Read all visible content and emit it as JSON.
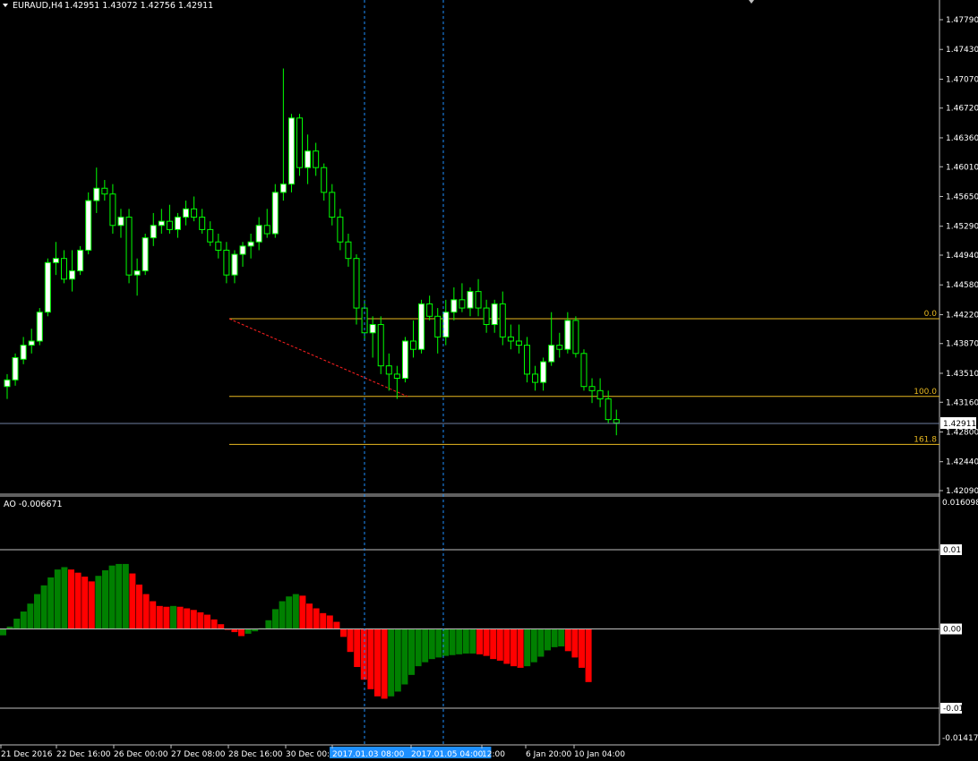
{
  "header": {
    "symbol_label": "EURAUD,H4",
    "ohlc_label": "1.42951 1.43072 1.42756 1.42911"
  },
  "price_axis": {
    "ticks": [
      "1.47790",
      "1.47430",
      "1.47070",
      "1.46720",
      "1.46360",
      "1.46010",
      "1.45650",
      "1.45290",
      "1.44940",
      "1.44580",
      "1.44220",
      "1.43870",
      "1.43510",
      "1.43160",
      "1.42800",
      "1.42440",
      "1.42090"
    ],
    "ymin": 1.4209,
    "ymax": 1.4779,
    "current_price_label": "1.42911",
    "current_price": 1.42911
  },
  "fibonacci": {
    "levels": [
      {
        "label": "0.0",
        "price": 1.4417
      },
      {
        "label": "100.0",
        "price": 1.4323
      },
      {
        "label": "161.8",
        "price": 1.4265
      }
    ],
    "color": "#e8b820",
    "trendline_color": "#ff2020"
  },
  "time_axis": {
    "labels": [
      "21 Dec 2016",
      "22 Dec 16:00",
      "26 Dec 00:00",
      "27 Dec 08:00",
      "28 Dec 16:00",
      "30 Dec 00:00",
      "2017.01.03 08:00",
      "2017.01.05 04:00",
      "12:00",
      "6 Jan 20:00",
      "10 Jan 04:00"
    ],
    "highlighted": [
      "2017.01.03 08:00",
      "2017.01.05 04:00"
    ]
  },
  "indicator": {
    "name_label": "AO -0.006671",
    "ticks": [
      "0.016098",
      "0.01",
      "0.00",
      "-0.01",
      "-0.014174"
    ],
    "up_color": "#008000",
    "down_color": "#ff0000"
  },
  "colors": {
    "background": "#000000",
    "bull_candle": "#ffffff",
    "candle_outline": "#00ff00",
    "grid": "#c0c0c0",
    "crosshair": "#1e90ff"
  },
  "chart_data": {
    "type": "candlestick",
    "symbol": "EURAUD",
    "timeframe": "H4",
    "candles": [
      {
        "o": 1.4335,
        "h": 1.435,
        "l": 1.432,
        "c": 1.4343
      },
      {
        "o": 1.4343,
        "h": 1.4375,
        "l": 1.4336,
        "c": 1.437
      },
      {
        "o": 1.4368,
        "h": 1.4395,
        "l": 1.4362,
        "c": 1.4385
      },
      {
        "o": 1.4385,
        "h": 1.4405,
        "l": 1.4375,
        "c": 1.439
      },
      {
        "o": 1.439,
        "h": 1.443,
        "l": 1.4385,
        "c": 1.4425
      },
      {
        "o": 1.4425,
        "h": 1.449,
        "l": 1.442,
        "c": 1.4485
      },
      {
        "o": 1.4485,
        "h": 1.451,
        "l": 1.447,
        "c": 1.449
      },
      {
        "o": 1.449,
        "h": 1.45,
        "l": 1.446,
        "c": 1.4465
      },
      {
        "o": 1.4465,
        "h": 1.45,
        "l": 1.445,
        "c": 1.4475
      },
      {
        "o": 1.4475,
        "h": 1.4505,
        "l": 1.447,
        "c": 1.45
      },
      {
        "o": 1.45,
        "h": 1.457,
        "l": 1.4495,
        "c": 1.456
      },
      {
        "o": 1.456,
        "h": 1.46,
        "l": 1.4545,
        "c": 1.4575
      },
      {
        "o": 1.4575,
        "h": 1.4585,
        "l": 1.456,
        "c": 1.4568
      },
      {
        "o": 1.4568,
        "h": 1.458,
        "l": 1.452,
        "c": 1.453
      },
      {
        "o": 1.453,
        "h": 1.455,
        "l": 1.4515,
        "c": 1.454
      },
      {
        "o": 1.454,
        "h": 1.455,
        "l": 1.446,
        "c": 1.447
      },
      {
        "o": 1.447,
        "h": 1.449,
        "l": 1.4445,
        "c": 1.4475
      },
      {
        "o": 1.4475,
        "h": 1.452,
        "l": 1.447,
        "c": 1.4515
      },
      {
        "o": 1.4515,
        "h": 1.4545,
        "l": 1.4505,
        "c": 1.453
      },
      {
        "o": 1.453,
        "h": 1.455,
        "l": 1.452,
        "c": 1.4535
      },
      {
        "o": 1.4535,
        "h": 1.4555,
        "l": 1.452,
        "c": 1.4525
      },
      {
        "o": 1.4525,
        "h": 1.4545,
        "l": 1.4515,
        "c": 1.454
      },
      {
        "o": 1.454,
        "h": 1.456,
        "l": 1.453,
        "c": 1.455
      },
      {
        "o": 1.455,
        "h": 1.4565,
        "l": 1.4535,
        "c": 1.454
      },
      {
        "o": 1.454,
        "h": 1.455,
        "l": 1.452,
        "c": 1.4525
      },
      {
        "o": 1.4525,
        "h": 1.4535,
        "l": 1.4505,
        "c": 1.451
      },
      {
        "o": 1.451,
        "h": 1.452,
        "l": 1.449,
        "c": 1.45
      },
      {
        "o": 1.45,
        "h": 1.451,
        "l": 1.446,
        "c": 1.447
      },
      {
        "o": 1.447,
        "h": 1.45,
        "l": 1.446,
        "c": 1.4495
      },
      {
        "o": 1.4495,
        "h": 1.451,
        "l": 1.448,
        "c": 1.4505
      },
      {
        "o": 1.4505,
        "h": 1.452,
        "l": 1.449,
        "c": 1.451
      },
      {
        "o": 1.451,
        "h": 1.454,
        "l": 1.45,
        "c": 1.453
      },
      {
        "o": 1.453,
        "h": 1.455,
        "l": 1.4515,
        "c": 1.452
      },
      {
        "o": 1.452,
        "h": 1.458,
        "l": 1.4515,
        "c": 1.457
      },
      {
        "o": 1.457,
        "h": 1.472,
        "l": 1.456,
        "c": 1.458
      },
      {
        "o": 1.458,
        "h": 1.4665,
        "l": 1.457,
        "c": 1.466
      },
      {
        "o": 1.466,
        "h": 1.4665,
        "l": 1.459,
        "c": 1.46
      },
      {
        "o": 1.46,
        "h": 1.464,
        "l": 1.458,
        "c": 1.462
      },
      {
        "o": 1.462,
        "h": 1.463,
        "l": 1.459,
        "c": 1.46
      },
      {
        "o": 1.46,
        "h": 1.4605,
        "l": 1.456,
        "c": 1.457
      },
      {
        "o": 1.457,
        "h": 1.458,
        "l": 1.453,
        "c": 1.454
      },
      {
        "o": 1.454,
        "h": 1.455,
        "l": 1.45,
        "c": 1.451
      },
      {
        "o": 1.451,
        "h": 1.452,
        "l": 1.448,
        "c": 1.449
      },
      {
        "o": 1.449,
        "h": 1.4495,
        "l": 1.441,
        "c": 1.443
      },
      {
        "o": 1.443,
        "h": 1.444,
        "l": 1.439,
        "c": 1.44
      },
      {
        "o": 1.44,
        "h": 1.442,
        "l": 1.437,
        "c": 1.441
      },
      {
        "o": 1.441,
        "h": 1.442,
        "l": 1.435,
        "c": 1.436
      },
      {
        "o": 1.436,
        "h": 1.4375,
        "l": 1.433,
        "c": 1.435
      },
      {
        "o": 1.435,
        "h": 1.436,
        "l": 1.432,
        "c": 1.4345
      },
      {
        "o": 1.4345,
        "h": 1.4395,
        "l": 1.434,
        "c": 1.439
      },
      {
        "o": 1.439,
        "h": 1.4415,
        "l": 1.437,
        "c": 1.438
      },
      {
        "o": 1.438,
        "h": 1.444,
        "l": 1.4375,
        "c": 1.4435
      },
      {
        "o": 1.4435,
        "h": 1.4445,
        "l": 1.4415,
        "c": 1.442
      },
      {
        "o": 1.442,
        "h": 1.443,
        "l": 1.4375,
        "c": 1.4395
      },
      {
        "o": 1.4395,
        "h": 1.444,
        "l": 1.4385,
        "c": 1.4425
      },
      {
        "o": 1.4425,
        "h": 1.4455,
        "l": 1.4415,
        "c": 1.444
      },
      {
        "o": 1.444,
        "h": 1.446,
        "l": 1.4425,
        "c": 1.443
      },
      {
        "o": 1.443,
        "h": 1.4455,
        "l": 1.442,
        "c": 1.445
      },
      {
        "o": 1.445,
        "h": 1.4465,
        "l": 1.442,
        "c": 1.443
      },
      {
        "o": 1.443,
        "h": 1.444,
        "l": 1.44,
        "c": 1.441
      },
      {
        "o": 1.441,
        "h": 1.444,
        "l": 1.44,
        "c": 1.4435
      },
      {
        "o": 1.4435,
        "h": 1.445,
        "l": 1.4385,
        "c": 1.4395
      },
      {
        "o": 1.4395,
        "h": 1.441,
        "l": 1.438,
        "c": 1.439
      },
      {
        "o": 1.439,
        "h": 1.441,
        "l": 1.4375,
        "c": 1.4385
      },
      {
        "o": 1.4385,
        "h": 1.4395,
        "l": 1.434,
        "c": 1.435
      },
      {
        "o": 1.435,
        "h": 1.436,
        "l": 1.433,
        "c": 1.434
      },
      {
        "o": 1.434,
        "h": 1.437,
        "l": 1.433,
        "c": 1.4365
      },
      {
        "o": 1.4365,
        "h": 1.4425,
        "l": 1.436,
        "c": 1.4385
      },
      {
        "o": 1.4385,
        "h": 1.44,
        "l": 1.437,
        "c": 1.438
      },
      {
        "o": 1.438,
        "h": 1.4425,
        "l": 1.4375,
        "c": 1.4415
      },
      {
        "o": 1.4415,
        "h": 1.442,
        "l": 1.437,
        "c": 1.4375
      },
      {
        "o": 1.4375,
        "h": 1.438,
        "l": 1.433,
        "c": 1.4335
      },
      {
        "o": 1.4335,
        "h": 1.4345,
        "l": 1.4315,
        "c": 1.433
      },
      {
        "o": 1.433,
        "h": 1.4345,
        "l": 1.431,
        "c": 1.432
      },
      {
        "o": 1.432,
        "h": 1.433,
        "l": 1.429,
        "c": 1.4295
      },
      {
        "o": 1.4295,
        "h": 1.4307,
        "l": 1.4276,
        "c": 1.4291
      }
    ],
    "ao": [
      -0.0008,
      0.0003,
      0.0013,
      0.0022,
      0.0032,
      0.0044,
      0.0055,
      0.0065,
      0.0075,
      0.0078,
      0.0075,
      0.0071,
      0.0066,
      0.006,
      0.0067,
      0.0074,
      0.008,
      0.0082,
      0.0082,
      0.007,
      0.0056,
      0.0044,
      0.0035,
      0.0029,
      0.0028,
      0.0029,
      0.0028,
      0.0026,
      0.0024,
      0.0021,
      0.0018,
      0.0012,
      0.0006,
      -0.0001,
      -0.0004,
      -0.0009,
      -0.0006,
      -0.0003,
      0.0001,
      0.0011,
      0.0025,
      0.0035,
      0.0041,
      0.0044,
      0.0042,
      0.0032,
      0.0026,
      0.002,
      0.0017,
      0.0009,
      -0.001,
      -0.0029,
      -0.0048,
      -0.0064,
      -0.0076,
      -0.0085,
      -0.0088,
      -0.0085,
      -0.0079,
      -0.007,
      -0.0058,
      -0.0047,
      -0.0042,
      -0.0038,
      -0.0036,
      -0.0034,
      -0.0033,
      -0.0032,
      -0.0031,
      -0.0031,
      -0.0032,
      -0.0034,
      -0.0038,
      -0.004,
      -0.0044,
      -0.0047,
      -0.0049,
      -0.0047,
      -0.0042,
      -0.0035,
      -0.0027,
      -0.0023,
      -0.0022,
      -0.0028,
      -0.0036,
      -0.0049,
      -0.0067
    ],
    "price_ylim": [
      1.4209,
      1.4779
    ],
    "ao_ylim": [
      -0.014174,
      0.016098
    ]
  }
}
